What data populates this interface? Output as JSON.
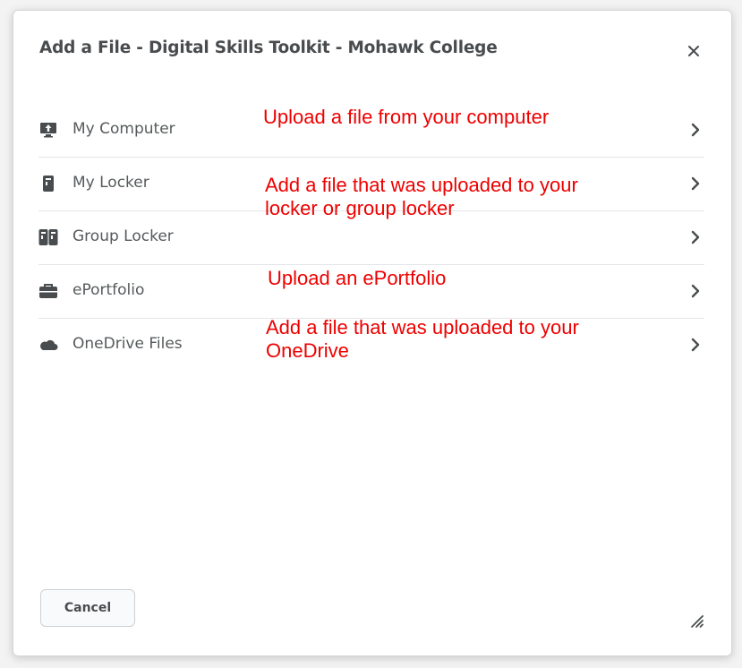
{
  "dialog": {
    "title": "Add a File - Digital Skills Toolkit - Mohawk College",
    "close_icon": "close-icon",
    "cancel_label": "Cancel",
    "resize_icon": "resize-grip-icon"
  },
  "sources": [
    {
      "label": "My Computer",
      "icon": "monitor-upload-icon"
    },
    {
      "label": "My Locker",
      "icon": "locker-icon"
    },
    {
      "label": "Group Locker",
      "icon": "group-locker-icon"
    },
    {
      "label": "ePortfolio",
      "icon": "briefcase-icon"
    },
    {
      "label": "OneDrive Files",
      "icon": "cloud-icon"
    }
  ],
  "annotations": {
    "my_computer": "Upload a file from your computer",
    "locker_line1": "Add a file that was uploaded to your",
    "locker_line2": "locker or group locker",
    "eportfolio": "Upload an ePortfolio",
    "onedrive_line1": "Add a file that was uploaded to your",
    "onedrive_line2": "OneDrive"
  },
  "colors": {
    "annotation": "#ee0000",
    "icon": "#494c4e",
    "text": "#565a5c"
  }
}
